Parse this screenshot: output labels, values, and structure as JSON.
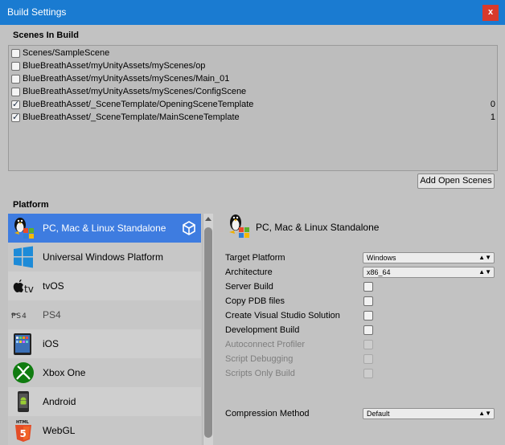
{
  "window": {
    "title": "Build Settings",
    "close_label": "x"
  },
  "scenes": {
    "label": "Scenes In Build",
    "items": [
      {
        "name": "Scenes/SampleScene",
        "checked": false,
        "index": ""
      },
      {
        "name": "BlueBreathAsset/myUnityAssets/myScenes/op",
        "checked": false,
        "index": ""
      },
      {
        "name": "BlueBreathAsset/myUnityAssets/myScenes/Main_01",
        "checked": false,
        "index": ""
      },
      {
        "name": "BlueBreathAsset/myUnityAssets/myScenes/ConfigScene",
        "checked": false,
        "index": ""
      },
      {
        "name": "BlueBreathAsset/_SceneTemplate/OpeningSceneTemplate",
        "checked": true,
        "index": "0"
      },
      {
        "name": "BlueBreathAsset/_SceneTemplate/MainSceneTemplate",
        "checked": true,
        "index": "1"
      }
    ],
    "add_open_scenes": "Add Open Scenes"
  },
  "platform": {
    "label": "Platform",
    "items": [
      {
        "label": "PC, Mac & Linux Standalone",
        "icon": "pc-mac-linux-icon",
        "selected": true
      },
      {
        "label": "Universal Windows Platform",
        "icon": "windows-logo-icon",
        "selected": false
      },
      {
        "label": "tvOS",
        "icon": "apple-tv-icon",
        "selected": false
      },
      {
        "label": "PS4",
        "icon": "ps4-logo-icon",
        "selected": false
      },
      {
        "label": "iOS",
        "icon": "ipad-icon",
        "selected": false
      },
      {
        "label": "Xbox One",
        "icon": "xbox-logo-icon",
        "selected": false
      },
      {
        "label": "Android",
        "icon": "android-phone-icon",
        "selected": false
      },
      {
        "label": "WebGL",
        "icon": "html5-icon",
        "selected": false
      }
    ]
  },
  "detail": {
    "title": "PC, Mac & Linux Standalone",
    "target_platform": {
      "label": "Target Platform",
      "value": "Windows"
    },
    "architecture": {
      "label": "Architecture",
      "value": "x86_64"
    },
    "checkboxes": [
      {
        "label": "Server Build",
        "enabled": true,
        "checked": false
      },
      {
        "label": "Copy PDB files",
        "enabled": true,
        "checked": false
      },
      {
        "label": "Create Visual Studio Solution",
        "enabled": true,
        "checked": false
      },
      {
        "label": "Development Build",
        "enabled": true,
        "checked": false
      },
      {
        "label": "Autoconnect Profiler",
        "enabled": false,
        "checked": false
      },
      {
        "label": "Script Debugging",
        "enabled": false,
        "checked": false
      },
      {
        "label": "Scripts Only Build",
        "enabled": false,
        "checked": false
      }
    ],
    "compression": {
      "label": "Compression Method",
      "value": "Default"
    }
  },
  "colors": {
    "titlebar": "#1a7bd1",
    "selection": "#3e7ce0",
    "close": "#d93a2b"
  }
}
